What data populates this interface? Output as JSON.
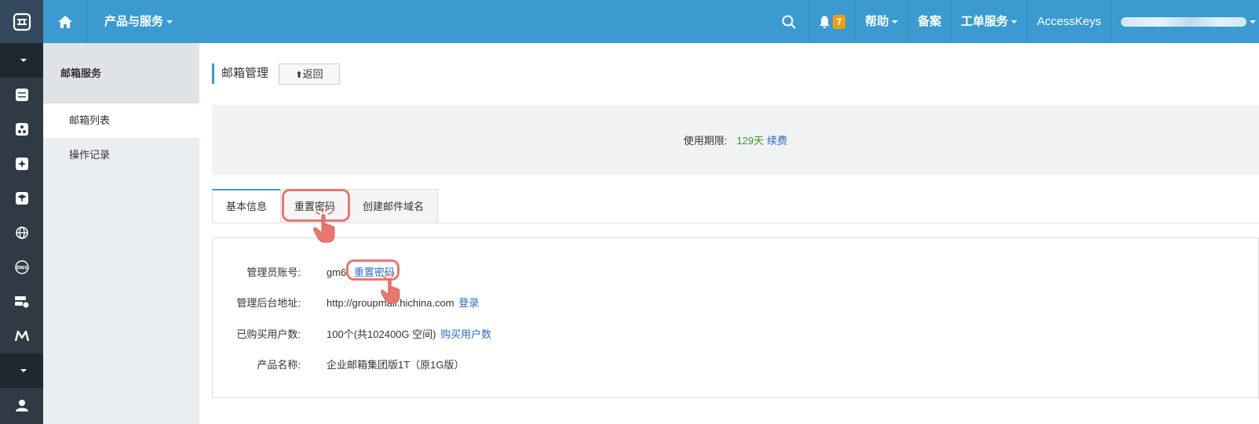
{
  "topbar": {
    "products_label": "产品与服务",
    "notification_count": "7",
    "help_label": "帮助",
    "beian_label": "备案",
    "ticket_label": "工单服务",
    "accesskeys_label": "AccessKeys"
  },
  "sidebar": {
    "title": "邮箱服务",
    "items": [
      {
        "label": "邮箱列表",
        "active": true
      },
      {
        "label": "操作记录",
        "active": false
      }
    ]
  },
  "page": {
    "title": "邮箱管理",
    "back_label": "返回",
    "banner": {
      "label": "使用期限:",
      "days": "129天",
      "renew_link": "续费"
    },
    "tabs": [
      {
        "label": "基本信息",
        "active": true
      },
      {
        "label": "重置密码",
        "active": false
      },
      {
        "label": "创建邮件域名",
        "active": false
      }
    ],
    "info": {
      "admin_label": "管理员账号:",
      "admin_value": "gm6",
      "admin_link": "重置密码",
      "backend_label": "管理后台地址:",
      "backend_value": "http://groupmail.hichina.com",
      "backend_link": "登录",
      "users_label": "已购买用户数:",
      "users_value": "100个(共102400G 空间)",
      "users_link": "购买用户数",
      "product_label": "产品名称:",
      "product_value": "企业邮箱集团版1T（原1G版）"
    }
  },
  "colors": {
    "topbar": "#3b9bd0",
    "rail": "#2f3a45",
    "accent_link": "#2b6cc2",
    "highlight": "#e8776f",
    "days_green": "#3e9b2a"
  }
}
